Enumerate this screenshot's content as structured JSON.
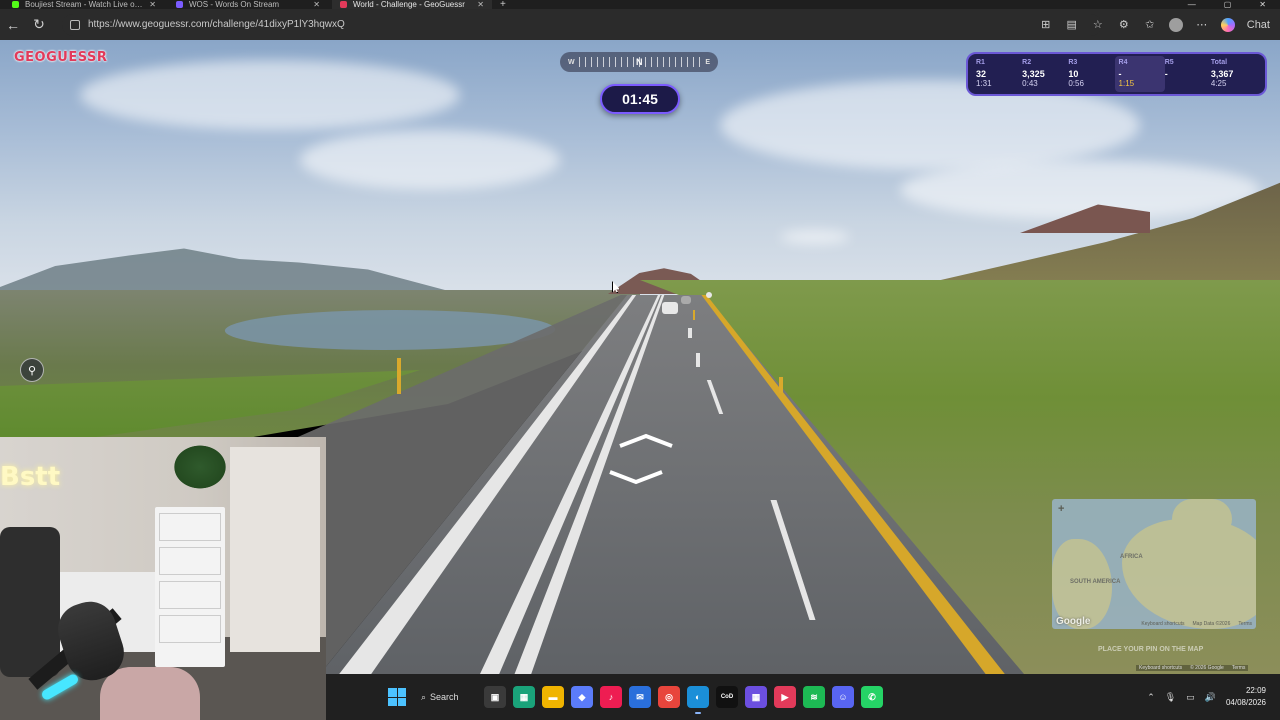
{
  "browser": {
    "tabs": [
      {
        "label": "Boujiest Stream - Watch Live on K",
        "active": false,
        "favicon_color": "#53fc18"
      },
      {
        "label": "WOS - Words On Stream",
        "active": false,
        "favicon_color": "#7b5cff"
      },
      {
        "label": "World - Challenge - GeoGuessr",
        "active": true,
        "favicon_color": "#e23a5a"
      }
    ],
    "url": "https://www.geoguessr.com/challenge/41dixyP1lY3hqwxQ",
    "chat_label": "Chat"
  },
  "game": {
    "logo": "GEOGUESSR",
    "compass": {
      "left": "W",
      "center": "N",
      "right": "E"
    },
    "timer": "01:45",
    "rounds": [
      {
        "label": "R1",
        "score": "32",
        "time": "1:31",
        "current": false
      },
      {
        "label": "R2",
        "score": "3,325",
        "time": "0:43",
        "current": false
      },
      {
        "label": "R3",
        "score": "10",
        "time": "0:56",
        "current": false
      },
      {
        "label": "R4",
        "score": "-",
        "time": "1:15",
        "current": true
      },
      {
        "label": "R5",
        "score": "-",
        "time": "",
        "current": false
      },
      {
        "label": "Total",
        "score": "3,367",
        "time": "4:25",
        "current": false
      }
    ],
    "minimap": {
      "zoom_in": "+",
      "labels": [
        "AFRICA",
        "SOUTH AMERICA"
      ],
      "google": "Google",
      "footer": [
        "Keyboard shortcuts",
        "Map Data ©2026",
        "Terms"
      ],
      "place_pin_hint": "PLACE YOUR PIN ON THE MAP"
    },
    "streetview_footer": [
      "Keyboard shortcuts",
      "© 2026 Google",
      "Terms"
    ]
  },
  "webcam": {
    "neon_text": "Bstt"
  },
  "taskbar": {
    "search_label": "Search",
    "apps": [
      {
        "name": "task-view",
        "color": "#3a3a3a",
        "glyph": "▣"
      },
      {
        "name": "calendar",
        "color": "#1aa37a",
        "glyph": "▦"
      },
      {
        "name": "file-explorer",
        "color": "#f0b400",
        "glyph": "▬"
      },
      {
        "name": "copilot",
        "color": "#5b7cfa",
        "glyph": "◆"
      },
      {
        "name": "tiktok",
        "color": "#ee1d52",
        "glyph": "♪"
      },
      {
        "name": "mail",
        "color": "#2a6fdb",
        "glyph": "✉"
      },
      {
        "name": "chrome",
        "color": "#e8453c",
        "glyph": "◎"
      },
      {
        "name": "edge",
        "color": "#1b8fd8",
        "glyph": "◐"
      },
      {
        "name": "call-of-duty",
        "color": "#111111",
        "glyph": "CoD"
      },
      {
        "name": "grid-app",
        "color": "#6c4fe0",
        "glyph": "▦"
      },
      {
        "name": "rewind",
        "color": "#e23a5a",
        "glyph": "▶"
      },
      {
        "name": "spotify",
        "color": "#1db954",
        "glyph": "≋"
      },
      {
        "name": "discord",
        "color": "#5865f2",
        "glyph": "☺"
      },
      {
        "name": "whatsapp",
        "color": "#25d366",
        "glyph": "✆"
      }
    ],
    "time": "22:09",
    "date": "04/08/2026"
  }
}
